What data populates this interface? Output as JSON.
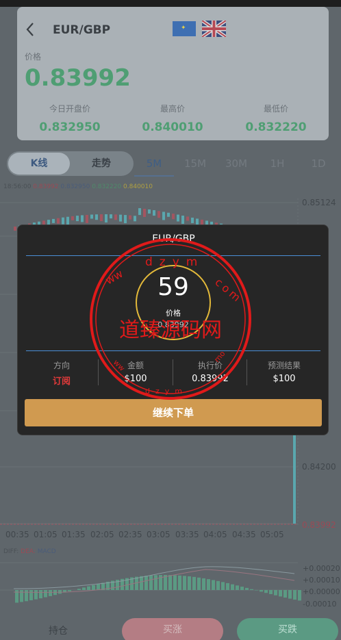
{
  "header": {
    "pair": "EUR/GBP",
    "price_label": "价格",
    "price": "0.83992",
    "stats": [
      {
        "label": "今日开盘价",
        "value": "0.832950"
      },
      {
        "label": "最高价",
        "value": "0.840010"
      },
      {
        "label": "最低价",
        "value": "0.832220"
      }
    ]
  },
  "tabs": {
    "segment": [
      "K线",
      "走势"
    ],
    "timeframes": [
      "5M",
      "15M",
      "30M",
      "1H",
      "1D"
    ],
    "active_timeframe": "5M"
  },
  "chart": {
    "legend": {
      "time": "18:56:00",
      "v1": "0.83992",
      "v2": "0.832950",
      "v3": "0.832220",
      "v4": "0.840010"
    },
    "y_labels": [
      "0.85124",
      "0.84200",
      "0.83992"
    ],
    "x_labels": [
      "00:35",
      "01:05",
      "01:35",
      "02:05",
      "02:35",
      "03:05",
      "03:35",
      "04:05",
      "04:35",
      "05:05"
    ],
    "diff_legend": {
      "diff": "DIFF:",
      "dea": "DEA:",
      "macd": "MACD"
    },
    "macd_labels": [
      "+0.00020",
      "+0.00010",
      "+0.00000",
      "-0.00010"
    ]
  },
  "modal": {
    "title": "EUR/GBP",
    "countdown": "59",
    "price_label": "价格",
    "price_value": "0.83992",
    "columns": [
      {
        "header": "方向",
        "value": "订阅"
      },
      {
        "header": "金额",
        "value": "$100"
      },
      {
        "header": "执行价",
        "value": "0.83992"
      },
      {
        "header": "预测结果",
        "value": "$100"
      }
    ],
    "button": "继续下单"
  },
  "bottom": {
    "positions": "持仓",
    "buy_up": "买涨",
    "buy_down": "买跌"
  },
  "watermark": {
    "text_cn": "道臻源码网",
    "letters_top": "dzym",
    "letters_bottom": "dzym",
    "com": "com"
  },
  "colors": {
    "green": "#4f9e73",
    "red": "#e03a3a",
    "accent_gold": "#d09a50",
    "ring": "#e3b93a",
    "line_blue": "#4b8fd8"
  }
}
